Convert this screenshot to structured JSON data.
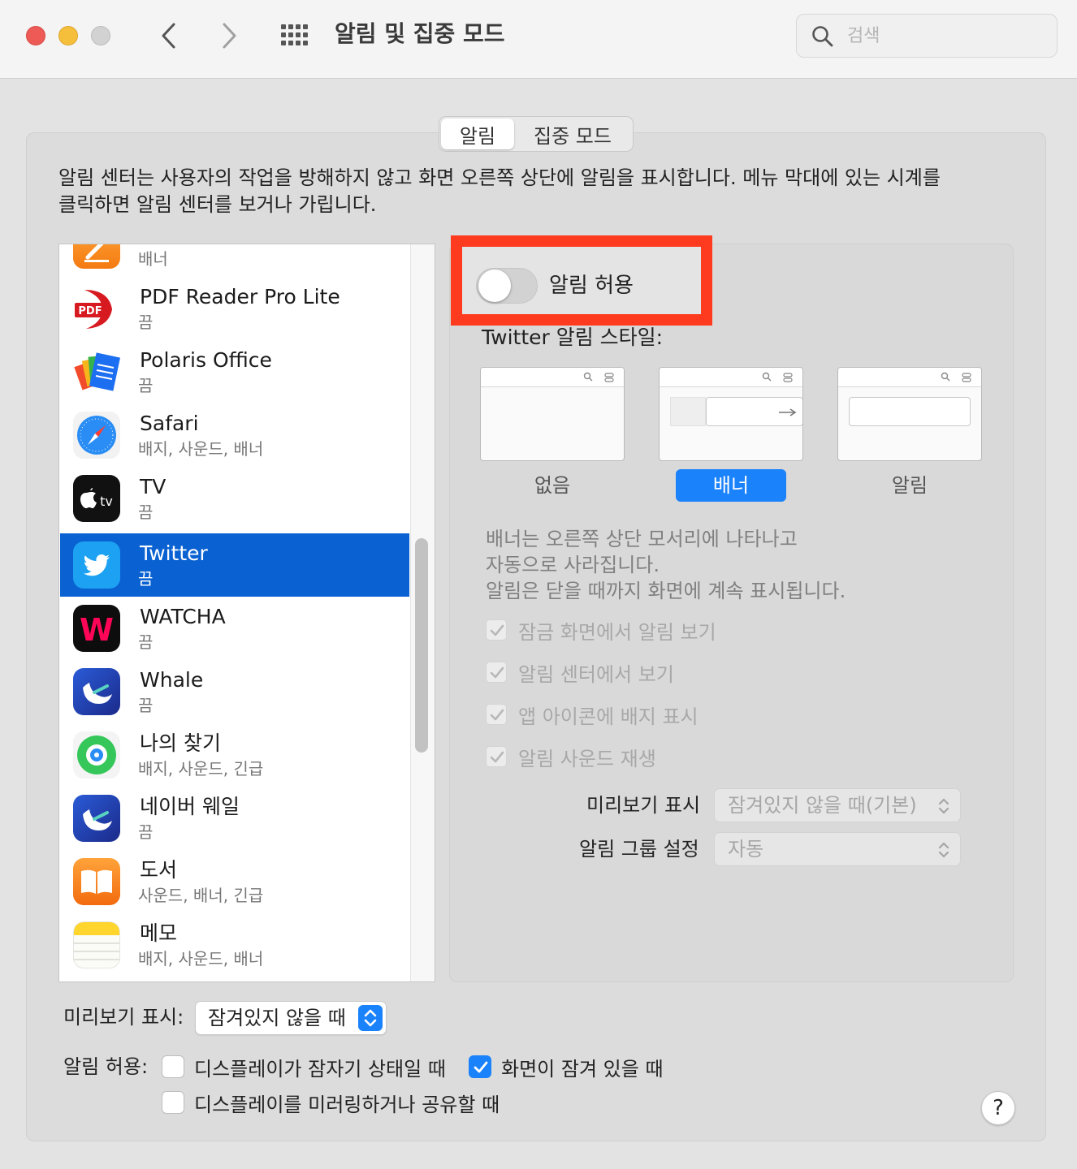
{
  "window": {
    "title": "알림 및 집중 모드",
    "search_placeholder": "검색"
  },
  "tabs": [
    {
      "label": "알림",
      "active": true
    },
    {
      "label": "집중 모드",
      "active": false
    }
  ],
  "description": {
    "line1": "알림 센터는 사용자의 작업을 방해하지 않고 화면 오른쪽 상단에 알림을 표시합니다. 메뉴 막대에 있는 시계를",
    "line2": "클릭하면 알림 센터를 보거나 가립니다."
  },
  "apps": [
    {
      "name": "",
      "sub": "배너",
      "icon": "pages-icon"
    },
    {
      "name": "PDF Reader Pro Lite",
      "sub": "끔",
      "icon": "pdf-reader-icon"
    },
    {
      "name": "Polaris Office",
      "sub": "끔",
      "icon": "polaris-office-icon"
    },
    {
      "name": "Safari",
      "sub": "배지, 사운드, 배너",
      "icon": "safari-icon"
    },
    {
      "name": "TV",
      "sub": "끔",
      "icon": "apple-tv-icon"
    },
    {
      "name": "Twitter",
      "sub": "끔",
      "icon": "twitter-icon",
      "selected": true
    },
    {
      "name": "WATCHA",
      "sub": "끔",
      "icon": "watcha-icon"
    },
    {
      "name": "Whale",
      "sub": "끔",
      "icon": "whale-icon"
    },
    {
      "name": "나의 찾기",
      "sub": "배지, 사운드, 긴급",
      "icon": "find-my-icon"
    },
    {
      "name": "네이버 웨일",
      "sub": "끔",
      "icon": "naver-whale-icon"
    },
    {
      "name": "도서",
      "sub": "사운드, 배너, 긴급",
      "icon": "books-icon"
    },
    {
      "name": "메모",
      "sub": "배지, 사운드, 배너",
      "icon": "notes-icon"
    }
  ],
  "tv_icon_text": "tv",
  "pdf_icon_text": "PDF",
  "watcha_icon_text": "W",
  "settings": {
    "allow_label": "알림 허용",
    "allow_on": false,
    "style_title": "Twitter 알림 스타일:",
    "styles": [
      {
        "label": "없음",
        "selected": false
      },
      {
        "label": "배너",
        "selected": true
      },
      {
        "label": "알림",
        "selected": false
      }
    ],
    "explain_line1": "배너는 오른쪽 상단 모서리에 나타나고",
    "explain_line2": "자동으로 사라집니다.",
    "explain_line3": "알림은 닫을 때까지 화면에 계속 표시됩니다.",
    "checks": [
      {
        "label": "잠금 화면에서 알림 보기",
        "checked": true
      },
      {
        "label": "알림 센터에서 보기",
        "checked": true
      },
      {
        "label": "앱 아이콘에 배지 표시",
        "checked": true
      },
      {
        "label": "알림 사운드 재생",
        "checked": true
      }
    ],
    "preview_label": "미리보기 표시",
    "preview_value": "잠겨있지 않을 때(기본)",
    "group_label": "알림 그룹 설정",
    "group_value": "자동"
  },
  "bottom": {
    "preview_label": "미리보기 표시:",
    "preview_value": "잠겨있지 않을 때",
    "allow_label": "알림 허용:",
    "opt_sleep": {
      "label": "디스플레이가 잠자기 상태일 때",
      "checked": false
    },
    "opt_locked": {
      "label": "화면이 잠겨 있을 때",
      "checked": true
    },
    "opt_mirror": {
      "label": "디스플레이를 미러링하거나 공유할 때",
      "checked": false
    },
    "help_label": "?"
  },
  "colors": {
    "accent": "#1a82fb",
    "selection": "#0a62d2",
    "highlight": "#ff3b1f"
  }
}
